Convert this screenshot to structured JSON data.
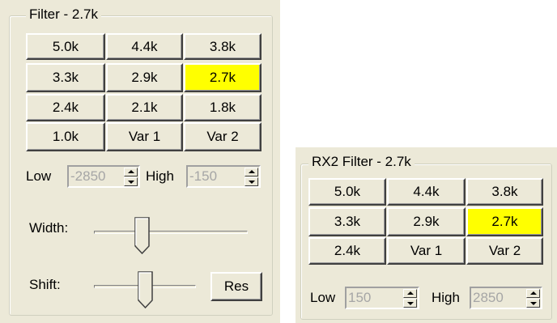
{
  "filter": {
    "title": "Filter - 2.7k",
    "buttons": [
      "5.0k",
      "4.4k",
      "3.8k",
      "3.3k",
      "2.9k",
      "2.7k",
      "2.4k",
      "2.1k",
      "1.8k",
      "1.0k",
      "Var 1",
      "Var 2"
    ],
    "selected": "2.7k",
    "low_label": "Low",
    "low_value": "-2850",
    "high_label": "High",
    "high_value": "-150",
    "width_label": "Width:",
    "shift_label": "Shift:",
    "res_label": "Res"
  },
  "rx2_filter": {
    "title": "RX2 Filter - 2.7k",
    "buttons": [
      "5.0k",
      "4.4k",
      "3.8k",
      "3.3k",
      "2.9k",
      "2.7k",
      "2.4k",
      "Var 1",
      "Var 2"
    ],
    "selected": "2.7k",
    "low_label": "Low",
    "low_value": "150",
    "high_label": "High",
    "high_value": "2850"
  },
  "colors": {
    "panel": "#ece9d8",
    "selected": "#ffff00",
    "disabled_text": "#a6a6a6"
  }
}
